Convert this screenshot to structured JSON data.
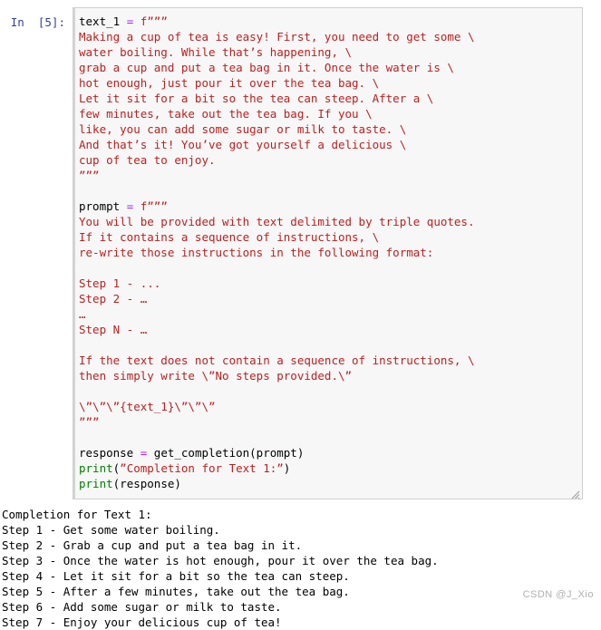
{
  "notebook": {
    "cell": {
      "prompt_label": "In  [5]:",
      "execution_count": "5",
      "resize_handle_icon": "resize-grip-icon",
      "code_lines": [
        {
          "segments": [
            {
              "text": "text_1 ",
              "type": "var"
            },
            {
              "text": "=",
              "type": "op"
            },
            {
              "text": " f”””",
              "type": "str"
            }
          ]
        },
        {
          "segments": [
            {
              "text": "Making a cup of tea is easy! First, you need to get some \\",
              "type": "str"
            }
          ]
        },
        {
          "segments": [
            {
              "text": "water boiling. While that’s happening, \\",
              "type": "str"
            }
          ]
        },
        {
          "segments": [
            {
              "text": "grab a cup and put a tea bag in it. Once the water is \\",
              "type": "str"
            }
          ]
        },
        {
          "segments": [
            {
              "text": "hot enough, just pour it over the tea bag. \\",
              "type": "str"
            }
          ]
        },
        {
          "segments": [
            {
              "text": "Let it sit for a bit so the tea can steep. After a \\",
              "type": "str"
            }
          ]
        },
        {
          "segments": [
            {
              "text": "few minutes, take out the tea bag. If you \\",
              "type": "str"
            }
          ]
        },
        {
          "segments": [
            {
              "text": "like, you can add some sugar or milk to taste. \\",
              "type": "str"
            }
          ]
        },
        {
          "segments": [
            {
              "text": "And that’s it! You’ve got yourself a delicious \\",
              "type": "str"
            }
          ]
        },
        {
          "segments": [
            {
              "text": "cup of tea to enjoy.",
              "type": "str"
            }
          ]
        },
        {
          "segments": [
            {
              "text": "”””",
              "type": "str"
            }
          ]
        },
        {
          "segments": [
            {
              "text": "",
              "type": "plain"
            }
          ]
        },
        {
          "segments": [
            {
              "text": "prompt ",
              "type": "var"
            },
            {
              "text": "=",
              "type": "op"
            },
            {
              "text": " f”””",
              "type": "str"
            }
          ]
        },
        {
          "segments": [
            {
              "text": "You will be provided with text delimited by triple quotes.",
              "type": "str"
            }
          ]
        },
        {
          "segments": [
            {
              "text": "If it contains a sequence of instructions, \\",
              "type": "str"
            }
          ]
        },
        {
          "segments": [
            {
              "text": "re-write those instructions in the following format:",
              "type": "str"
            }
          ]
        },
        {
          "segments": [
            {
              "text": "",
              "type": "plain"
            }
          ]
        },
        {
          "segments": [
            {
              "text": "Step 1 - ...",
              "type": "str"
            }
          ]
        },
        {
          "segments": [
            {
              "text": "Step 2 - …",
              "type": "str"
            }
          ]
        },
        {
          "segments": [
            {
              "text": "…",
              "type": "str"
            }
          ]
        },
        {
          "segments": [
            {
              "text": "Step N - …",
              "type": "str"
            }
          ]
        },
        {
          "segments": [
            {
              "text": "",
              "type": "plain"
            }
          ]
        },
        {
          "segments": [
            {
              "text": "If the text does not contain a sequence of instructions, \\",
              "type": "str"
            }
          ]
        },
        {
          "segments": [
            {
              "text": "then simply write \\”No steps provided.\\”",
              "type": "str"
            }
          ]
        },
        {
          "segments": [
            {
              "text": "",
              "type": "plain"
            }
          ]
        },
        {
          "segments": [
            {
              "text": "\\”\\”\\”{text_1}\\”\\”\\”",
              "type": "str"
            }
          ]
        },
        {
          "segments": [
            {
              "text": "”””",
              "type": "str"
            }
          ]
        },
        {
          "segments": [
            {
              "text": "",
              "type": "plain"
            }
          ]
        },
        {
          "segments": [
            {
              "text": "response ",
              "type": "var"
            },
            {
              "text": "=",
              "type": "op"
            },
            {
              "text": " get_completion(prompt)",
              "type": "plain"
            }
          ]
        },
        {
          "segments": [
            {
              "text": "print",
              "type": "fn"
            },
            {
              "text": "(",
              "type": "plain"
            },
            {
              "text": "”Completion for Text 1:”",
              "type": "str"
            },
            {
              "text": ")",
              "type": "plain"
            }
          ]
        },
        {
          "segments": [
            {
              "text": "print",
              "type": "fn"
            },
            {
              "text": "(response)",
              "type": "plain"
            }
          ]
        }
      ]
    },
    "output": {
      "lines": [
        "Completion for Text 1:",
        "Step 1 - Get some water boiling.",
        "Step 2 - Grab a cup and put a tea bag in it.",
        "Step 3 - Once the water is hot enough, pour it over the tea bag.",
        "Step 4 - Let it sit for a bit so the tea can steep.",
        "Step 5 - After a few minutes, take out the tea bag.",
        "Step 6 - Add some sugar or milk to taste.",
        "Step 7 - Enjoy your delicious cup of tea!"
      ]
    }
  },
  "watermark": {
    "text": "CSDN @J_Xio"
  },
  "colors": {
    "prompt": "#303f9f",
    "string": "#ba2121",
    "operator": "#aa22ff",
    "function": "#008000",
    "cell_bg": "#f7f7f7",
    "cell_border": "#cfcfcf",
    "watermark": "#b0b0b0"
  }
}
